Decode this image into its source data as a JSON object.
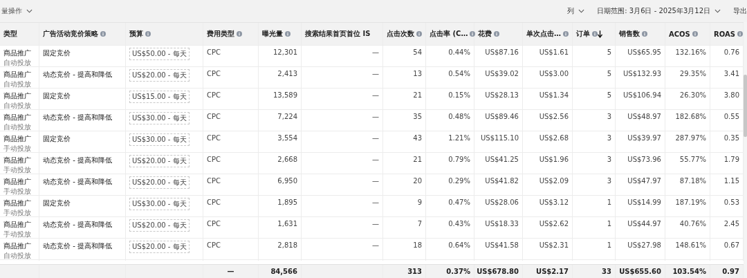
{
  "toolbar": {
    "bulk_actions": "量操作",
    "columns_button": "列",
    "date_range": "日期范围: 3月6日 - 2025年3月12日",
    "export": "导出"
  },
  "table": {
    "columns": [
      {
        "label": "类型",
        "info": false,
        "sorted": false
      },
      {
        "label": "广告活动竞价策略",
        "info": true,
        "sorted": false
      },
      {
        "label": "预算",
        "info": true,
        "sorted": false
      },
      {
        "label": "费用类型",
        "info": true,
        "sorted": false
      },
      {
        "label": "曝光量",
        "info": true,
        "sorted": false
      },
      {
        "label": "搜索结果首页首位 IS",
        "info": false,
        "sorted": false
      },
      {
        "label": "点击次数",
        "info": true,
        "sorted": false
      },
      {
        "label": "点击率 (C…",
        "info": true,
        "sorted": false
      },
      {
        "label": "花费",
        "info": true,
        "sorted": false
      },
      {
        "label": "单次点击…",
        "info": true,
        "sorted": false
      },
      {
        "label": "订单",
        "info": true,
        "sorted": true
      },
      {
        "label": "销售数",
        "info": true,
        "sorted": false
      },
      {
        "label": "ACOS",
        "info": true,
        "sorted": false
      },
      {
        "label": "ROAS",
        "info": true,
        "sorted": false
      }
    ],
    "rows": [
      {
        "targeting": "自动投放",
        "cells": [
          "商品推广",
          "固定竞价",
          "US$50.00 - 每天",
          "CPC",
          "12,301",
          "—",
          "54",
          "0.44%",
          "US$87.16",
          "US$1.61",
          "5",
          "US$65.95",
          "132.16%",
          "0.76"
        ]
      },
      {
        "targeting": "自动投放",
        "cells": [
          "商品推广",
          "动态竞价 - 提高和降低",
          "US$20.00 - 每天",
          "CPC",
          "2,413",
          "—",
          "13",
          "0.54%",
          "US$39.02",
          "US$3.00",
          "5",
          "US$132.93",
          "29.35%",
          "3.41"
        ]
      },
      {
        "targeting": "自动投放",
        "cells": [
          "商品推广",
          "固定竞价",
          "US$15.00 - 每天",
          "CPC",
          "13,589",
          "—",
          "21",
          "0.15%",
          "US$28.13",
          "US$1.34",
          "5",
          "US$106.94",
          "26.30%",
          "3.80"
        ]
      },
      {
        "targeting": "自动投放",
        "cells": [
          "商品推广",
          "动态竞价 - 提高和降低",
          "US$30.00 - 每天",
          "CPC",
          "7,224",
          "—",
          "35",
          "0.48%",
          "US$89.46",
          "US$2.56",
          "3",
          "US$48.97",
          "182.68%",
          "0.55"
        ]
      },
      {
        "targeting": "手动投放",
        "cells": [
          "商品推广",
          "固定竞价",
          "US$30.00 - 每天",
          "CPC",
          "3,554",
          "—",
          "43",
          "1.21%",
          "US$115.10",
          "US$2.68",
          "3",
          "US$39.97",
          "287.97%",
          "0.35"
        ]
      },
      {
        "targeting": "手动投放",
        "cells": [
          "商品推广",
          "动态竞价 - 提高和降低",
          "US$20.00 - 每天",
          "CPC",
          "2,668",
          "—",
          "21",
          "0.79%",
          "US$41.25",
          "US$1.96",
          "3",
          "US$73.96",
          "55.77%",
          "1.79"
        ]
      },
      {
        "targeting": "手动投放",
        "cells": [
          "商品推广",
          "动态竞价 - 提高和降低",
          "US$20.00 - 每天",
          "CPC",
          "6,950",
          "—",
          "20",
          "0.29%",
          "US$41.82",
          "US$2.09",
          "3",
          "US$47.97",
          "87.18%",
          "1.15"
        ]
      },
      {
        "targeting": "手动投放",
        "cells": [
          "商品推广",
          "固定竞价",
          "US$30.00 - 每天",
          "CPC",
          "1,895",
          "—",
          "9",
          "0.47%",
          "US$28.06",
          "US$3.12",
          "1",
          "US$14.99",
          "187.19%",
          "0.53"
        ]
      },
      {
        "targeting": "手动投放",
        "cells": [
          "商品推广",
          "动态竞价 - 提高和降低",
          "US$20.00 - 每天",
          "CPC",
          "1,631",
          "—",
          "7",
          "0.43%",
          "US$18.33",
          "US$2.62",
          "1",
          "US$44.97",
          "40.76%",
          "2.45"
        ]
      },
      {
        "targeting": "自动投放",
        "cells": [
          "商品推广",
          "动态竞价 - 提高和降低",
          "US$20.00 - 每天",
          "CPC",
          "2,818",
          "—",
          "18",
          "0.64%",
          "US$41.58",
          "US$2.31",
          "1",
          "US$27.98",
          "148.61%",
          "0.67"
        ]
      }
    ],
    "totals": {
      "cost_type": "—",
      "impressions": "84,566",
      "metrics": [
        "313",
        "0.37%",
        "US$678.80",
        "US$2.17",
        "33",
        "US$655.60",
        "103.54%",
        "0.97"
      ]
    }
  }
}
